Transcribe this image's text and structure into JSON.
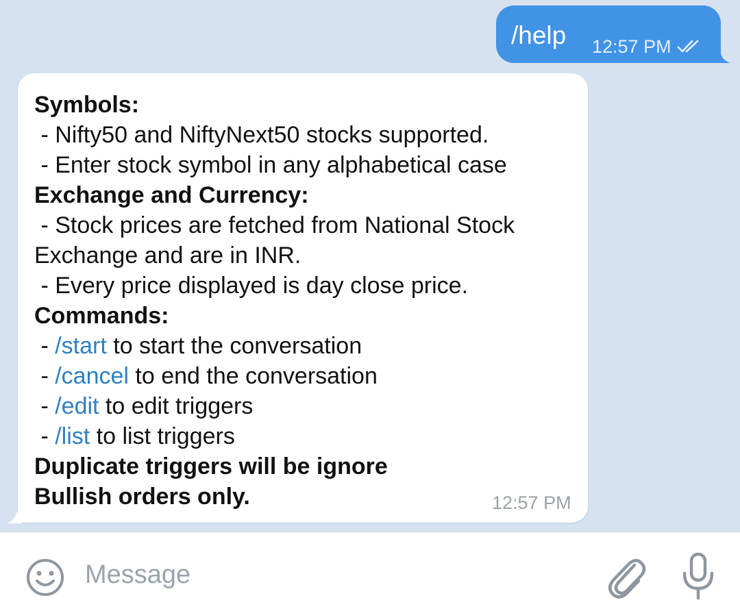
{
  "outgoing": {
    "text": "/help",
    "time": "12:57 PM",
    "status_icon": "double-check-icon"
  },
  "incoming": {
    "time": "12:57 PM",
    "lines": [
      {
        "parts": [
          {
            "text": "Symbols:",
            "style": "bold"
          }
        ]
      },
      {
        "parts": [
          {
            "text": " - Nifty50 and NiftyNext50 stocks supported.",
            "style": "normal"
          }
        ]
      },
      {
        "parts": [
          {
            "text": " - Enter stock symbol in any alphabetical case",
            "style": "normal"
          }
        ]
      },
      {
        "parts": [
          {
            "text": "Exchange and Currency:",
            "style": "bold"
          }
        ]
      },
      {
        "parts": [
          {
            "text": " - Stock prices are fetched from National Stock",
            "style": "normal"
          }
        ]
      },
      {
        "parts": [
          {
            "text": "Exchange and are in INR.",
            "style": "normal"
          }
        ]
      },
      {
        "parts": [
          {
            "text": " - Every price displayed is day close price.",
            "style": "normal"
          }
        ]
      },
      {
        "parts": [
          {
            "text": "Commands:",
            "style": "bold"
          }
        ]
      },
      {
        "parts": [
          {
            "text": " - ",
            "style": "normal"
          },
          {
            "text": "/start",
            "style": "link"
          },
          {
            "text": " to start the conversation",
            "style": "normal"
          }
        ]
      },
      {
        "parts": [
          {
            "text": " - ",
            "style": "normal"
          },
          {
            "text": "/cancel",
            "style": "link"
          },
          {
            "text": " to end the conversation",
            "style": "normal"
          }
        ]
      },
      {
        "parts": [
          {
            "text": " - ",
            "style": "normal"
          },
          {
            "text": "/edit",
            "style": "link"
          },
          {
            "text": " to edit triggers",
            "style": "normal"
          }
        ]
      },
      {
        "parts": [
          {
            "text": " - ",
            "style": "normal"
          },
          {
            "text": "/list",
            "style": "link"
          },
          {
            "text": " to list triggers",
            "style": "normal"
          }
        ]
      },
      {
        "parts": [
          {
            "text": "Duplicate triggers will be ignore",
            "style": "bold"
          }
        ]
      },
      {
        "parts": [
          {
            "text": "Bullish orders only.",
            "style": "bold"
          }
        ]
      }
    ]
  },
  "input_bar": {
    "placeholder": "Message",
    "value": "",
    "emoji_icon": "smiley-icon",
    "attach_icon": "paperclip-icon",
    "mic_icon": "microphone-icon"
  },
  "colors": {
    "chat_background": "#d7e2f0",
    "outgoing_bubble": "#4193e6",
    "incoming_bubble": "#ffffff",
    "link": "#2f7fc2",
    "icon_gray": "#8e969f"
  }
}
